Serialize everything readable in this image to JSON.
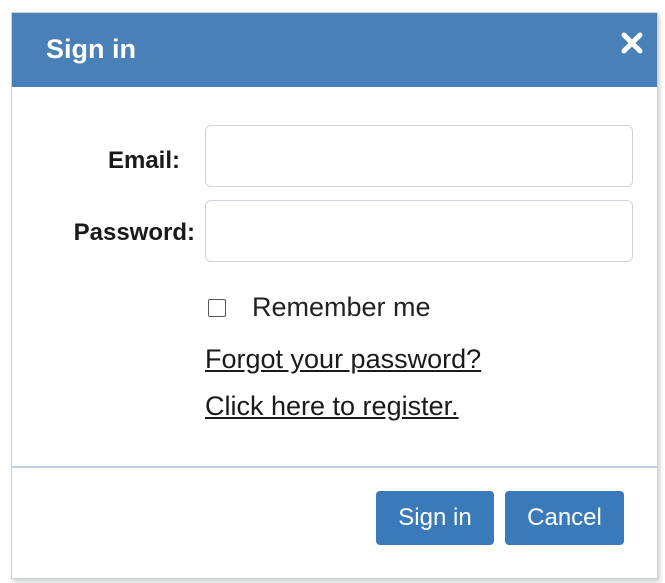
{
  "dialog": {
    "title": "Sign in",
    "close_icon": "close-icon"
  },
  "form": {
    "email_label": "Email:",
    "email_value": "",
    "password_label": "Password:",
    "password_value": "",
    "remember_label": "Remember me",
    "remember_checked": false,
    "forgot_link": "Forgot your password?",
    "register_link": "Click here to register."
  },
  "footer": {
    "signin_label": "Sign in",
    "cancel_label": "Cancel"
  },
  "colors": {
    "titlebar": "#4a80b8",
    "button": "#3b7ab8",
    "divider": "#bcd0e4"
  }
}
